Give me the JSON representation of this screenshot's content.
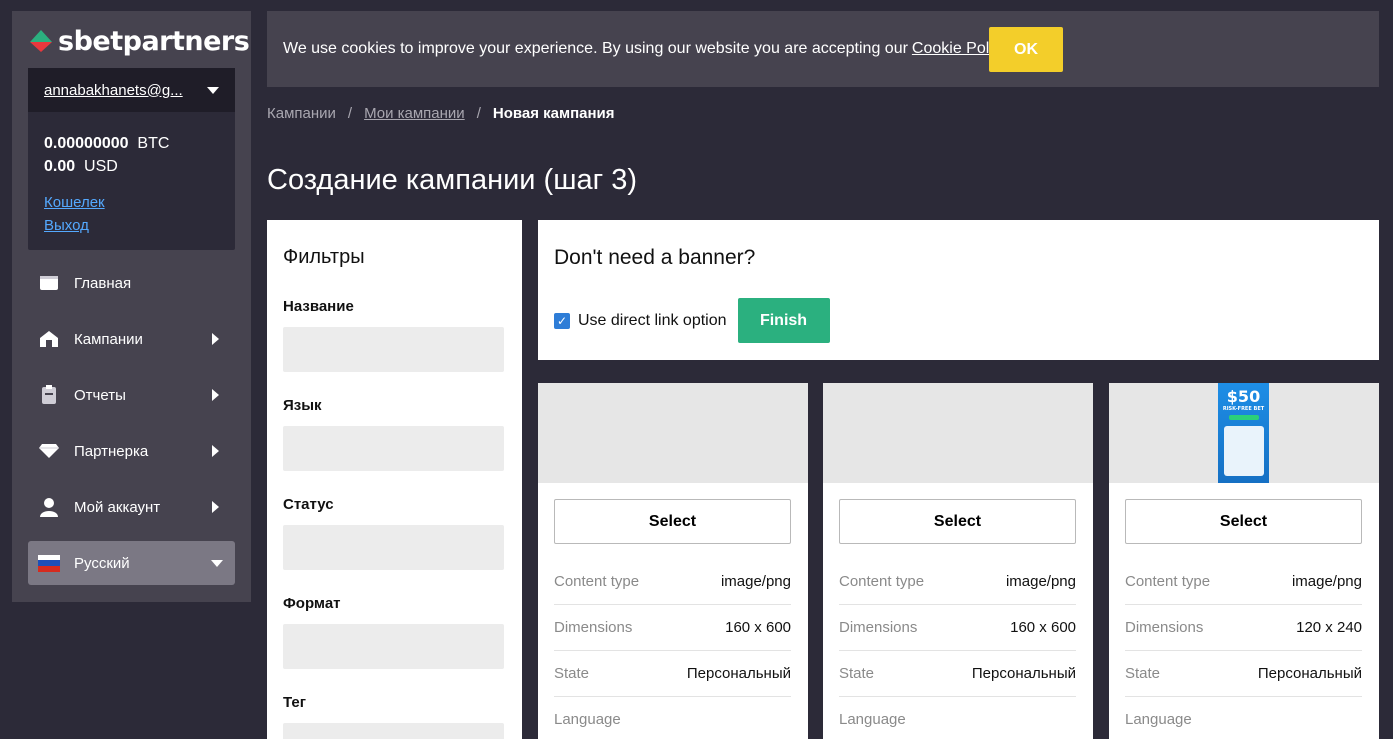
{
  "brand": {
    "logo_text": "sbetpartners"
  },
  "account": {
    "email": "annabakhanets@g...",
    "balances": [
      {
        "amount": "0.00000000",
        "currency": "BTC"
      },
      {
        "amount": "0.00",
        "currency": "USD"
      }
    ],
    "wallet_link": "Кошелек",
    "logout_link": "Выход"
  },
  "nav": {
    "home": "Главная",
    "campaigns": "Кампании",
    "reports": "Отчеты",
    "partner": "Партнерка",
    "my_account": "Мой аккаунт",
    "language": "Русский"
  },
  "cookie": {
    "text": "We use cookies to improve your experience. By using our website you are accepting our",
    "policy_link": "Cookie Policy",
    "ok_label": "OK"
  },
  "breadcrumb": {
    "root": "Кампании",
    "my_campaigns": "Мои кампании",
    "current": "Новая кампания",
    "separator": "/"
  },
  "page_title": "Создание кампании (шаг 3)",
  "filters": {
    "title": "Фильтры",
    "fields": [
      "Название",
      "Язык",
      "Статус",
      "Формат",
      "Тег"
    ]
  },
  "no_banner": {
    "title": "Don't need a banner?",
    "checkbox_label": "Use direct link option",
    "checkbox_checked": true,
    "finish_label": "Finish"
  },
  "cards": [
    {
      "select_label": "Select",
      "rows": [
        {
          "k": "Content type",
          "v": "image/png"
        },
        {
          "k": "Dimensions",
          "v": "160 x 600"
        },
        {
          "k": "State",
          "v": "Персональный"
        },
        {
          "k": "Language",
          "v": ""
        }
      ]
    },
    {
      "select_label": "Select",
      "rows": [
        {
          "k": "Content type",
          "v": "image/png"
        },
        {
          "k": "Dimensions",
          "v": "160 x 600"
        },
        {
          "k": "State",
          "v": "Персональный"
        },
        {
          "k": "Language",
          "v": ""
        }
      ]
    },
    {
      "select_label": "Select",
      "banner_amount": "$50",
      "banner_tagline": "RISK-FREE BET",
      "rows": [
        {
          "k": "Content type",
          "v": "image/png"
        },
        {
          "k": "Dimensions",
          "v": "120 x 240"
        },
        {
          "k": "State",
          "v": "Персональный"
        },
        {
          "k": "Language",
          "v": ""
        }
      ]
    }
  ],
  "colors": {
    "background": "#2c2a38",
    "sidebar": "#46434f",
    "accent_yellow": "#f3ce2a",
    "accent_green": "#2bb07f",
    "link_blue": "#54a9ff"
  }
}
